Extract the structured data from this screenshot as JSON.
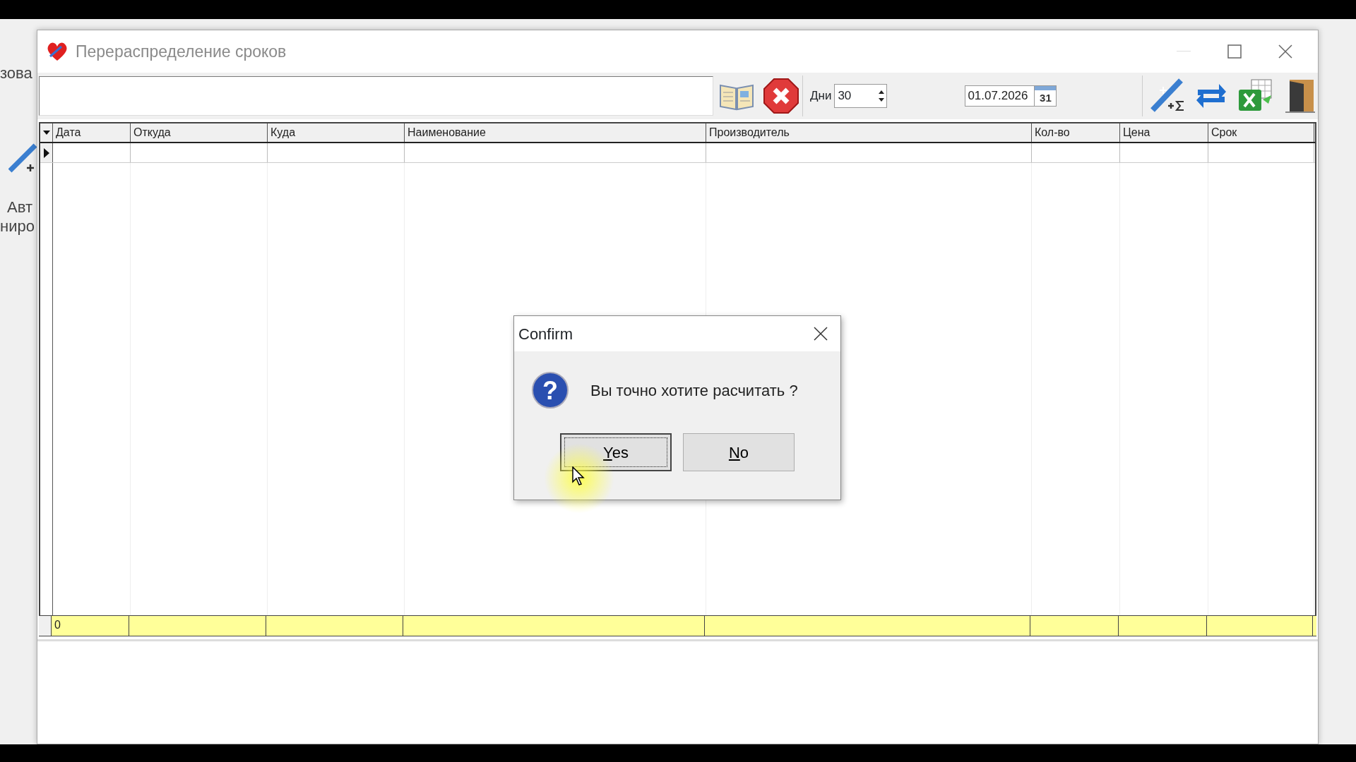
{
  "background_window": {
    "texts": [
      "зова",
      "Авт",
      "ниро"
    ]
  },
  "window": {
    "title": "Перераспределение сроков"
  },
  "toolbar": {
    "days_label": "Дни",
    "days_value": "30",
    "date_value": "01.07.2026",
    "calendar_day": "31"
  },
  "table": {
    "columns": [
      "Дата",
      "Откуда",
      "Куда",
      "Наименование",
      "Производитель",
      "Кол-во",
      "Цена",
      "Срок"
    ],
    "current_row": true
  },
  "footer": {
    "total": "0"
  },
  "dialog": {
    "title": "Confirm",
    "icon_glyph": "?",
    "message": "Вы точно хотите расчитать ?",
    "buttons": [
      {
        "label": "Yes",
        "mnemonic": true,
        "focused": true
      },
      {
        "label": "No",
        "mnemonic": true,
        "focused": false
      }
    ]
  }
}
